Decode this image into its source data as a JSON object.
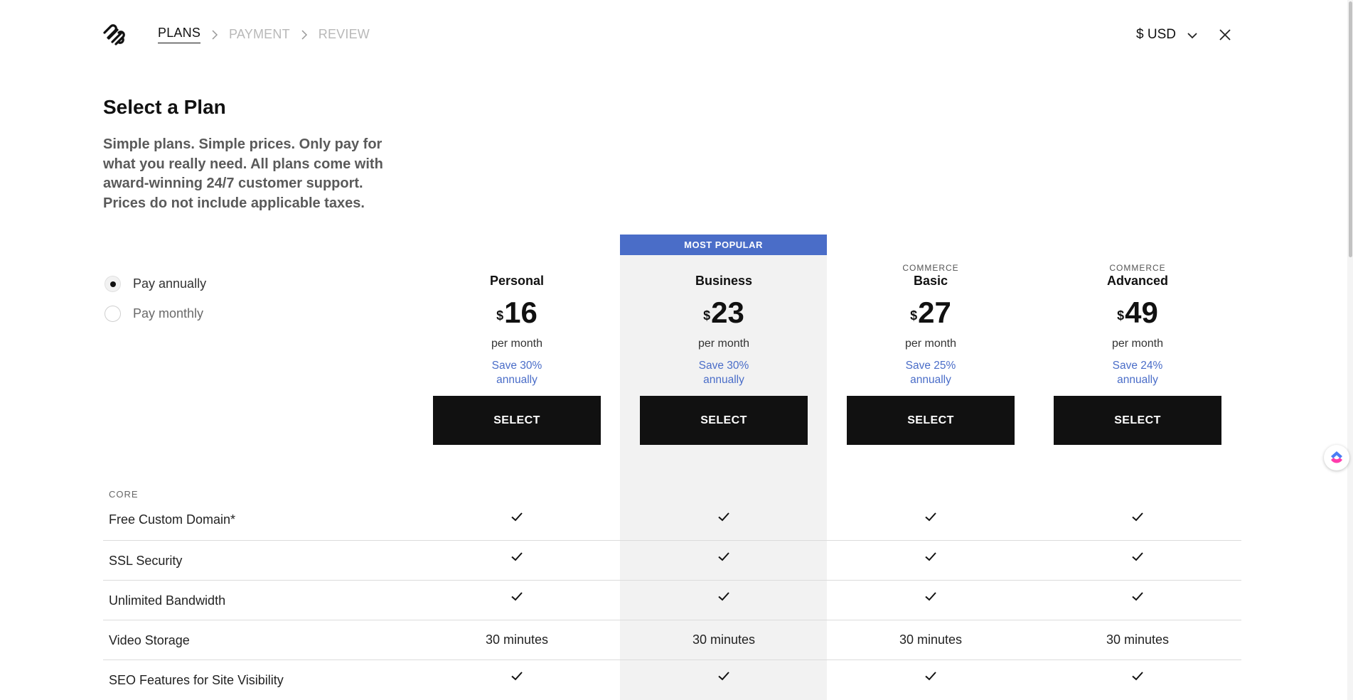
{
  "header": {
    "steps": [
      "PLANS",
      "PAYMENT",
      "REVIEW"
    ],
    "currency_label": "$ USD"
  },
  "intro": {
    "title": "Select a Plan",
    "subtitle": "Simple plans. Simple prices. Only pay for what you really need. All plans come with award-winning 24/7 customer support. Prices do not include applicable taxes."
  },
  "billing": {
    "options": [
      "Pay annually",
      "Pay monthly"
    ],
    "selected": "Pay annually"
  },
  "popular_banner": "MOST POPULAR",
  "plans": [
    {
      "tag": "",
      "name": "Personal",
      "currency": "$",
      "price": "16",
      "per": "per month",
      "save_line1": "Save 30%",
      "save_line2": "annually",
      "button": "SELECT"
    },
    {
      "tag": "",
      "name": "Business",
      "currency": "$",
      "price": "23",
      "per": "per month",
      "save_line1": "Save 30%",
      "save_line2": "annually",
      "button": "SELECT"
    },
    {
      "tag": "COMMERCE",
      "name": "Basic",
      "currency": "$",
      "price": "27",
      "per": "per month",
      "save_line1": "Save 25%",
      "save_line2": "annually",
      "button": "SELECT"
    },
    {
      "tag": "COMMERCE",
      "name": "Advanced",
      "currency": "$",
      "price": "49",
      "per": "per month",
      "save_line1": "Save 24%",
      "save_line2": "annually",
      "button": "SELECT"
    }
  ],
  "features": {
    "section": "CORE",
    "rows": [
      {
        "name": "Free Custom Domain*",
        "values": [
          "check",
          "check",
          "check",
          "check"
        ]
      },
      {
        "name": "SSL Security",
        "values": [
          "check",
          "check",
          "check",
          "check"
        ]
      },
      {
        "name": "Unlimited Bandwidth",
        "values": [
          "check",
          "check",
          "check",
          "check"
        ]
      },
      {
        "name": "Video Storage",
        "values": [
          "30 minutes",
          "30 minutes",
          "30 minutes",
          "30 minutes"
        ]
      },
      {
        "name": "SEO Features for Site Visibility",
        "values": [
          "check",
          "check",
          "check",
          "check"
        ]
      }
    ]
  },
  "colors": {
    "accent_blue": "#4a6dc8",
    "button_black": "#111111",
    "highlight_gray": "#f2f2f2"
  }
}
